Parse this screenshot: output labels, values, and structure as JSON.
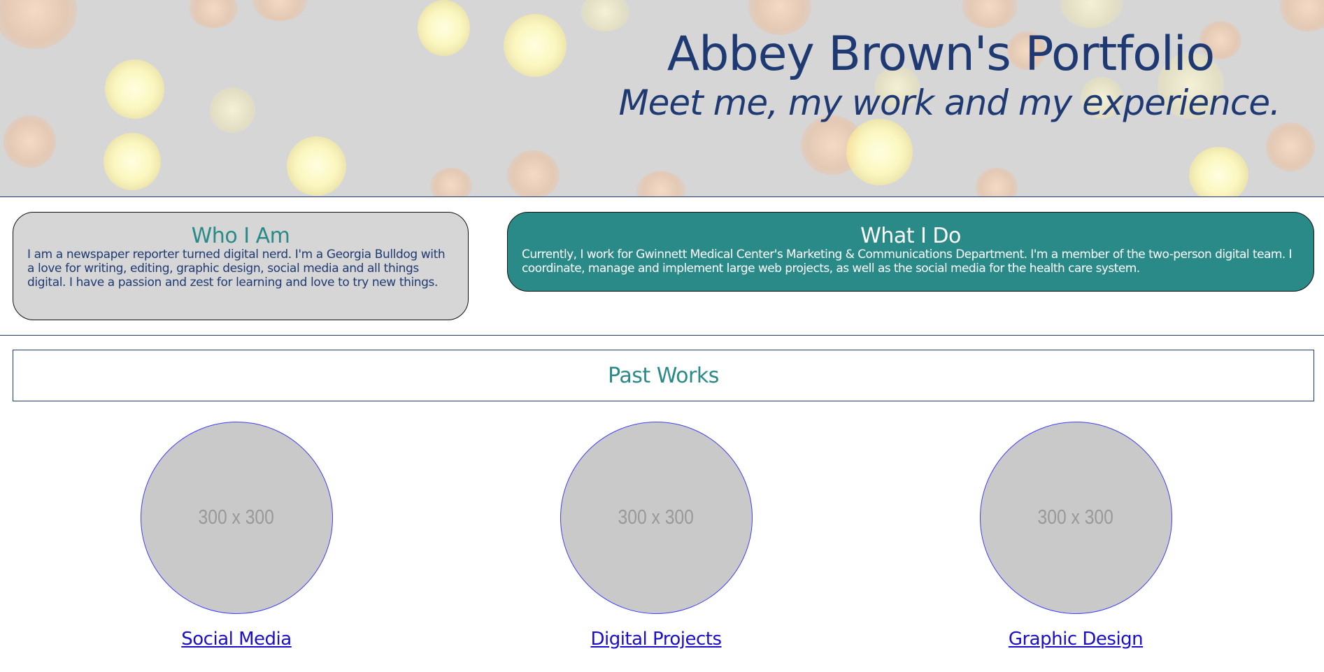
{
  "hero": {
    "title": "Abbey Brown's Portfolio",
    "subtitle": "Meet me, my work and my experience."
  },
  "who": {
    "heading": "Who I Am",
    "body": "I am a newspaper reporter turned digital nerd. I'm a Georgia Bulldog with a love for writing, editing, graphic design, social media and all things digital. I have a passion and zest for learning and love to try new things."
  },
  "what": {
    "heading": "What I Do",
    "body": "Currently, I work for Gwinnett Medical Center's Marketing & Communications Department. I'm a member of the two-person digital team. I coordinate, manage and implement large web projects, as well as the social media for the health care system."
  },
  "past_works": {
    "heading": "Past Works",
    "items": [
      {
        "placeholder": "300 x 300",
        "label": "Social Media"
      },
      {
        "placeholder": "300 x 300",
        "label": "Digital Projects"
      },
      {
        "placeholder": "300 x 300",
        "label": "Graphic Design"
      }
    ]
  },
  "colors": {
    "navy": "#1f3a73",
    "teal": "#2a8a87",
    "card_gray": "#d6d6d6",
    "placeholder_gray": "#c9c9c9",
    "link": "#1a0dcc"
  }
}
